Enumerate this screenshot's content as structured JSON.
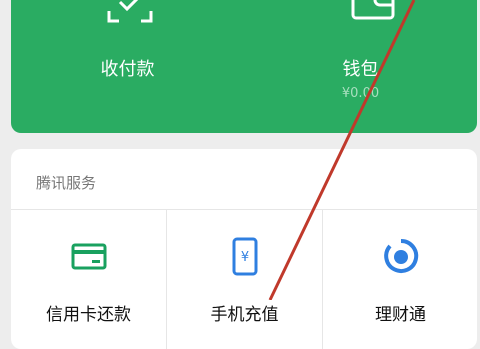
{
  "top_card": {
    "pay": {
      "label": "收付款",
      "icon": "qr-scan-check-icon"
    },
    "wallet": {
      "label": "钱包",
      "balance": "¥0.00",
      "icon": "wallet-icon"
    },
    "colors": {
      "background": "#2aac62"
    }
  },
  "services": {
    "title": "腾讯服务",
    "items": [
      {
        "label": "信用卡还款",
        "icon": "credit-card-icon",
        "color": "#19a15f"
      },
      {
        "label": "手机充值",
        "icon": "phone-recharge-icon",
        "color": "#2f7fe0"
      },
      {
        "label": "理财通",
        "icon": "wealth-icon",
        "color": "#2f7fe0"
      }
    ]
  },
  "annotation": {
    "color": "#c0392b"
  }
}
